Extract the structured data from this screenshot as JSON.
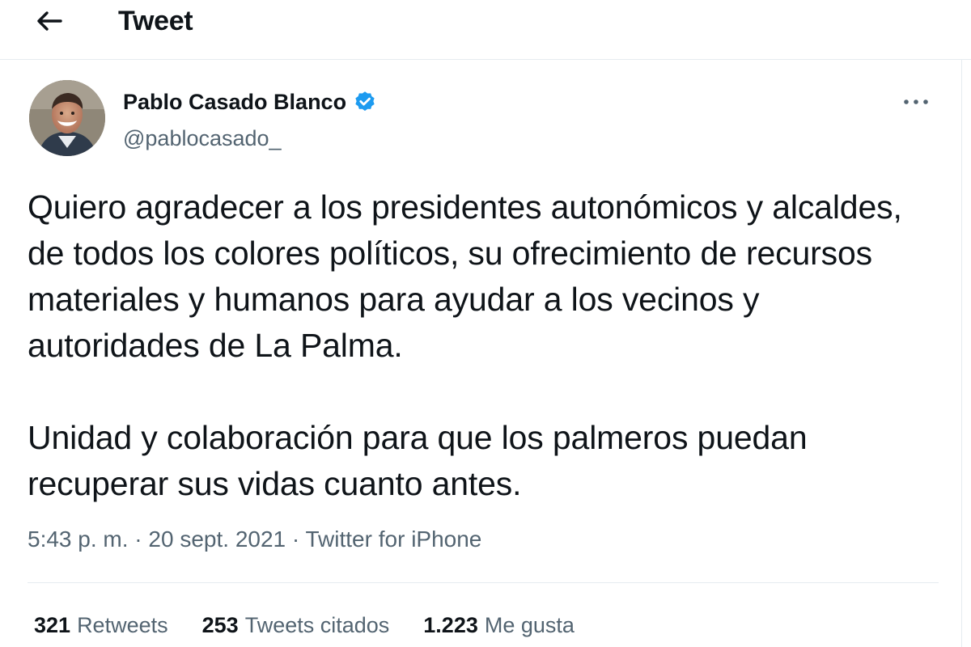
{
  "header": {
    "title": "Tweet",
    "back_icon": "arrow-left-icon"
  },
  "author": {
    "name": "Pablo Casado Blanco",
    "handle": "@pablocasado_",
    "verified_icon": "verified-badge-icon",
    "verified_color": "#1d9bf0"
  },
  "tweet": {
    "paragraphs": [
      "Quiero agradecer a los presidentes autonómicos y alcaldes, de todos los colores políticos, su ofrecimiento de recursos materiales y humanos para ayudar a los vecinos y autoridades de La Palma.",
      "Unidad y colaboración para que los palmeros puedan recuperar sus vidas cuanto antes."
    ],
    "time": "5:43 p. m.",
    "date": "20 sept. 2021",
    "source": "Twitter for iPhone",
    "separator": "·"
  },
  "stats": [
    {
      "count": "321",
      "label": "Retweets"
    },
    {
      "count": "253",
      "label": "Tweets citados"
    },
    {
      "count": "1.223",
      "label": "Me gusta"
    }
  ],
  "actions": {
    "more_icon": "more-horizontal-icon"
  },
  "colors": {
    "text_primary": "#0f1419",
    "text_secondary": "#536471",
    "divider": "#e6ecf0"
  }
}
